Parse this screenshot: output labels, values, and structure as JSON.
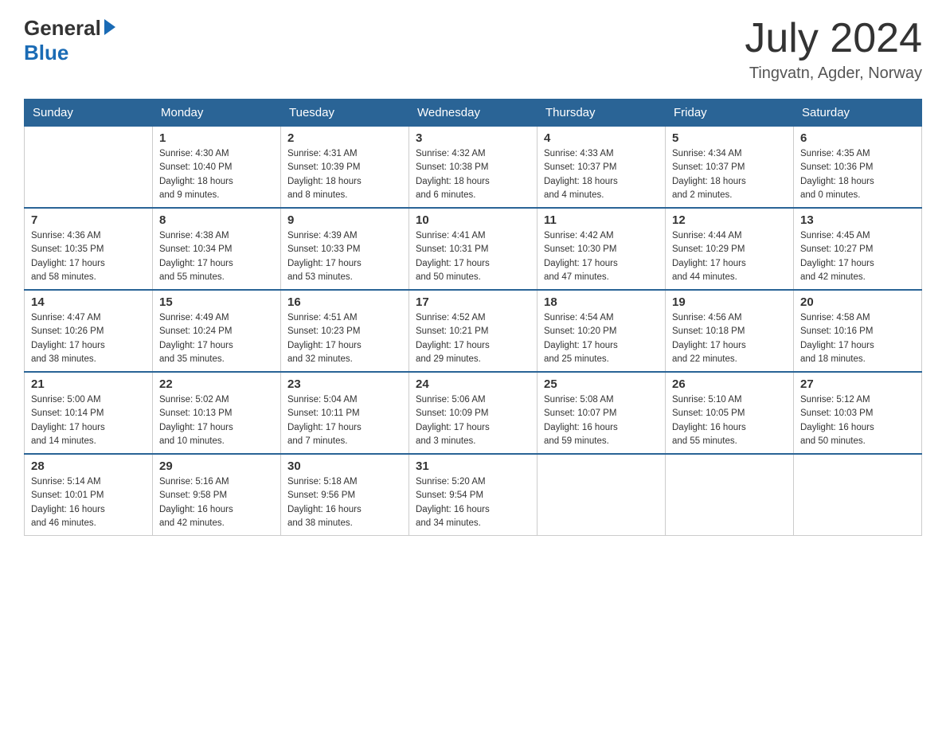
{
  "logo": {
    "general": "General",
    "blue": "Blue"
  },
  "title": "July 2024",
  "location": "Tingvatn, Agder, Norway",
  "weekdays": [
    "Sunday",
    "Monday",
    "Tuesday",
    "Wednesday",
    "Thursday",
    "Friday",
    "Saturday"
  ],
  "weeks": [
    [
      {
        "num": "",
        "info": ""
      },
      {
        "num": "1",
        "info": "Sunrise: 4:30 AM\nSunset: 10:40 PM\nDaylight: 18 hours\nand 9 minutes."
      },
      {
        "num": "2",
        "info": "Sunrise: 4:31 AM\nSunset: 10:39 PM\nDaylight: 18 hours\nand 8 minutes."
      },
      {
        "num": "3",
        "info": "Sunrise: 4:32 AM\nSunset: 10:38 PM\nDaylight: 18 hours\nand 6 minutes."
      },
      {
        "num": "4",
        "info": "Sunrise: 4:33 AM\nSunset: 10:37 PM\nDaylight: 18 hours\nand 4 minutes."
      },
      {
        "num": "5",
        "info": "Sunrise: 4:34 AM\nSunset: 10:37 PM\nDaylight: 18 hours\nand 2 minutes."
      },
      {
        "num": "6",
        "info": "Sunrise: 4:35 AM\nSunset: 10:36 PM\nDaylight: 18 hours\nand 0 minutes."
      }
    ],
    [
      {
        "num": "7",
        "info": "Sunrise: 4:36 AM\nSunset: 10:35 PM\nDaylight: 17 hours\nand 58 minutes."
      },
      {
        "num": "8",
        "info": "Sunrise: 4:38 AM\nSunset: 10:34 PM\nDaylight: 17 hours\nand 55 minutes."
      },
      {
        "num": "9",
        "info": "Sunrise: 4:39 AM\nSunset: 10:33 PM\nDaylight: 17 hours\nand 53 minutes."
      },
      {
        "num": "10",
        "info": "Sunrise: 4:41 AM\nSunset: 10:31 PM\nDaylight: 17 hours\nand 50 minutes."
      },
      {
        "num": "11",
        "info": "Sunrise: 4:42 AM\nSunset: 10:30 PM\nDaylight: 17 hours\nand 47 minutes."
      },
      {
        "num": "12",
        "info": "Sunrise: 4:44 AM\nSunset: 10:29 PM\nDaylight: 17 hours\nand 44 minutes."
      },
      {
        "num": "13",
        "info": "Sunrise: 4:45 AM\nSunset: 10:27 PM\nDaylight: 17 hours\nand 42 minutes."
      }
    ],
    [
      {
        "num": "14",
        "info": "Sunrise: 4:47 AM\nSunset: 10:26 PM\nDaylight: 17 hours\nand 38 minutes."
      },
      {
        "num": "15",
        "info": "Sunrise: 4:49 AM\nSunset: 10:24 PM\nDaylight: 17 hours\nand 35 minutes."
      },
      {
        "num": "16",
        "info": "Sunrise: 4:51 AM\nSunset: 10:23 PM\nDaylight: 17 hours\nand 32 minutes."
      },
      {
        "num": "17",
        "info": "Sunrise: 4:52 AM\nSunset: 10:21 PM\nDaylight: 17 hours\nand 29 minutes."
      },
      {
        "num": "18",
        "info": "Sunrise: 4:54 AM\nSunset: 10:20 PM\nDaylight: 17 hours\nand 25 minutes."
      },
      {
        "num": "19",
        "info": "Sunrise: 4:56 AM\nSunset: 10:18 PM\nDaylight: 17 hours\nand 22 minutes."
      },
      {
        "num": "20",
        "info": "Sunrise: 4:58 AM\nSunset: 10:16 PM\nDaylight: 17 hours\nand 18 minutes."
      }
    ],
    [
      {
        "num": "21",
        "info": "Sunrise: 5:00 AM\nSunset: 10:14 PM\nDaylight: 17 hours\nand 14 minutes."
      },
      {
        "num": "22",
        "info": "Sunrise: 5:02 AM\nSunset: 10:13 PM\nDaylight: 17 hours\nand 10 minutes."
      },
      {
        "num": "23",
        "info": "Sunrise: 5:04 AM\nSunset: 10:11 PM\nDaylight: 17 hours\nand 7 minutes."
      },
      {
        "num": "24",
        "info": "Sunrise: 5:06 AM\nSunset: 10:09 PM\nDaylight: 17 hours\nand 3 minutes."
      },
      {
        "num": "25",
        "info": "Sunrise: 5:08 AM\nSunset: 10:07 PM\nDaylight: 16 hours\nand 59 minutes."
      },
      {
        "num": "26",
        "info": "Sunrise: 5:10 AM\nSunset: 10:05 PM\nDaylight: 16 hours\nand 55 minutes."
      },
      {
        "num": "27",
        "info": "Sunrise: 5:12 AM\nSunset: 10:03 PM\nDaylight: 16 hours\nand 50 minutes."
      }
    ],
    [
      {
        "num": "28",
        "info": "Sunrise: 5:14 AM\nSunset: 10:01 PM\nDaylight: 16 hours\nand 46 minutes."
      },
      {
        "num": "29",
        "info": "Sunrise: 5:16 AM\nSunset: 9:58 PM\nDaylight: 16 hours\nand 42 minutes."
      },
      {
        "num": "30",
        "info": "Sunrise: 5:18 AM\nSunset: 9:56 PM\nDaylight: 16 hours\nand 38 minutes."
      },
      {
        "num": "31",
        "info": "Sunrise: 5:20 AM\nSunset: 9:54 PM\nDaylight: 16 hours\nand 34 minutes."
      },
      {
        "num": "",
        "info": ""
      },
      {
        "num": "",
        "info": ""
      },
      {
        "num": "",
        "info": ""
      }
    ]
  ]
}
